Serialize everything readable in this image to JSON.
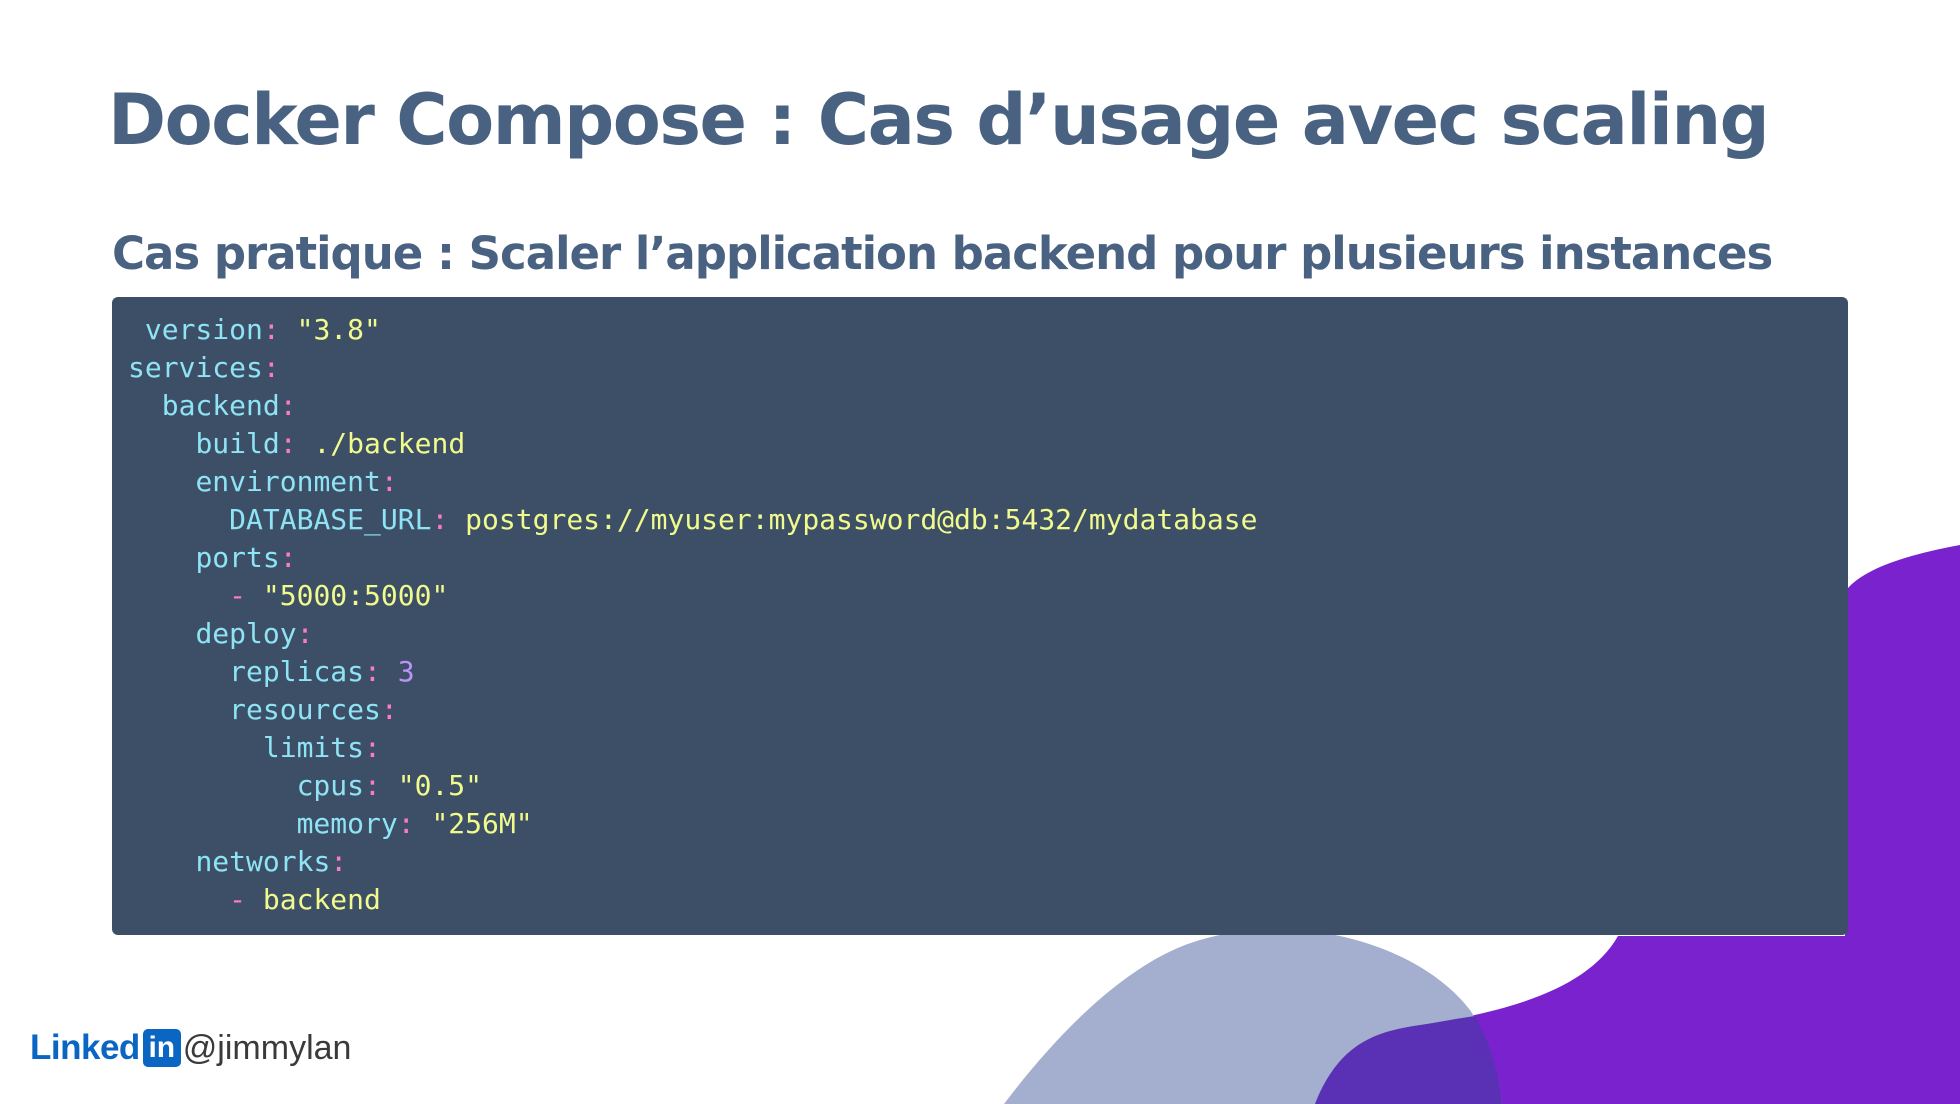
{
  "slide": {
    "title": "Docker Compose : Cas d’usage avec scaling",
    "subtitle": "Cas pratique : Scaler l’application backend pour plusieurs instances"
  },
  "code": {
    "lines": [
      {
        "indent": " ",
        "key": "version",
        "sep": ": ",
        "value": "\"3.8\"",
        "value_type": "string"
      },
      {
        "indent": "",
        "key": "services",
        "sep": ":"
      },
      {
        "indent": "  ",
        "key": "backend",
        "sep": ":"
      },
      {
        "indent": "    ",
        "key": "build",
        "sep": ": ",
        "value": "./backend",
        "value_type": "string"
      },
      {
        "indent": "    ",
        "key": "environment",
        "sep": ":"
      },
      {
        "indent": "      ",
        "key": "DATABASE_URL",
        "sep": ": ",
        "value": "postgres://myuser:mypassword@db:5432/mydatabase",
        "value_type": "string"
      },
      {
        "indent": "    ",
        "key": "ports",
        "sep": ":"
      },
      {
        "indent": "      ",
        "dash": "- ",
        "value": "\"5000:5000\"",
        "value_type": "string"
      },
      {
        "indent": "    ",
        "key": "deploy",
        "sep": ":"
      },
      {
        "indent": "      ",
        "key": "replicas",
        "sep": ": ",
        "value": "3",
        "value_type": "number"
      },
      {
        "indent": "      ",
        "key": "resources",
        "sep": ":"
      },
      {
        "indent": "        ",
        "key": "limits",
        "sep": ":"
      },
      {
        "indent": "          ",
        "key": "cpus",
        "sep": ": ",
        "value": "\"0.5\"",
        "value_type": "string"
      },
      {
        "indent": "          ",
        "key": "memory",
        "sep": ": ",
        "value": "\"256M\"",
        "value_type": "string"
      },
      {
        "indent": "    ",
        "key": "networks",
        "sep": ":"
      },
      {
        "indent": "      ",
        "dash": "- ",
        "value": "backend",
        "value_type": "string"
      }
    ]
  },
  "footer": {
    "brand_text": "Linked",
    "brand_box": "in",
    "handle": "@jimmylan"
  },
  "colors": {
    "title": "#4a6282",
    "code_bg": "#3d4f66",
    "yaml_key": "#8ee3f5",
    "yaml_punct": "#ff79c6",
    "yaml_string": "#f1fa8c",
    "yaml_number": "#bd93f9",
    "decor_purple": "#7b22cf",
    "decor_lavender": "#a4aecf",
    "decor_overlap": "#5a31b4",
    "linkedin_blue": "#0a66c2"
  }
}
